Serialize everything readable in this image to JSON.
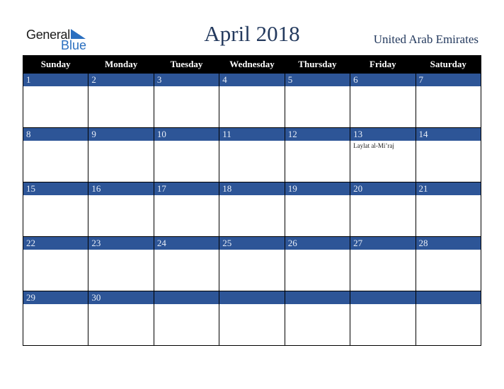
{
  "logo": {
    "word1": "General",
    "word2": "Blue"
  },
  "header": {
    "title": "April 2018",
    "country": "United Arab Emirates"
  },
  "colors": {
    "header_bg": "#000000",
    "date_bar": "#2d5597",
    "title": "#243a5e",
    "logo_blue": "#2a6fc0"
  },
  "weekdays": [
    "Sunday",
    "Monday",
    "Tuesday",
    "Wednesday",
    "Thursday",
    "Friday",
    "Saturday"
  ],
  "weeks": [
    [
      {
        "d": "1",
        "e": ""
      },
      {
        "d": "2",
        "e": ""
      },
      {
        "d": "3",
        "e": ""
      },
      {
        "d": "4",
        "e": ""
      },
      {
        "d": "5",
        "e": ""
      },
      {
        "d": "6",
        "e": ""
      },
      {
        "d": "7",
        "e": ""
      }
    ],
    [
      {
        "d": "8",
        "e": ""
      },
      {
        "d": "9",
        "e": ""
      },
      {
        "d": "10",
        "e": ""
      },
      {
        "d": "11",
        "e": ""
      },
      {
        "d": "12",
        "e": ""
      },
      {
        "d": "13",
        "e": "Laylat al-Mi’raj"
      },
      {
        "d": "14",
        "e": ""
      }
    ],
    [
      {
        "d": "15",
        "e": ""
      },
      {
        "d": "16",
        "e": ""
      },
      {
        "d": "17",
        "e": ""
      },
      {
        "d": "18",
        "e": ""
      },
      {
        "d": "19",
        "e": ""
      },
      {
        "d": "20",
        "e": ""
      },
      {
        "d": "21",
        "e": ""
      }
    ],
    [
      {
        "d": "22",
        "e": ""
      },
      {
        "d": "23",
        "e": ""
      },
      {
        "d": "24",
        "e": ""
      },
      {
        "d": "25",
        "e": ""
      },
      {
        "d": "26",
        "e": ""
      },
      {
        "d": "27",
        "e": ""
      },
      {
        "d": "28",
        "e": ""
      }
    ],
    [
      {
        "d": "29",
        "e": ""
      },
      {
        "d": "30",
        "e": ""
      },
      {
        "d": "",
        "e": ""
      },
      {
        "d": "",
        "e": ""
      },
      {
        "d": "",
        "e": ""
      },
      {
        "d": "",
        "e": ""
      },
      {
        "d": "",
        "e": ""
      }
    ]
  ]
}
